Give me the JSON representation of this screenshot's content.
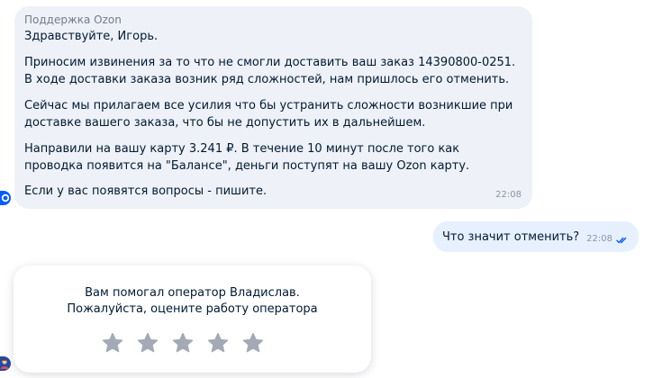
{
  "incoming": {
    "sender": "Поддержка Ozon",
    "greeting": "Здравствуйте, Игорь.",
    "paragraphs": [
      "Приносим извинения за то что не смогли доставить ваш заказ 14390800-0251. В ходе доставки заказа возник ряд сложностей, нам пришлось его отменить.",
      "Сейчас мы прилагаем все усилия что бы устранить сложности возникшие при доставке вашего заказа, что бы не допустить их в дальнейшем.",
      "Направили на вашу карту 3.241 ₽. В течение 10 минут после того как проводка появится на \"Балансе\", деньги поступят на вашу Ozon карту.",
      "Если у вас появятся вопросы - пишите."
    ],
    "time": "22:08"
  },
  "outgoing": {
    "text": "Что значит отменить?",
    "time": "22:08",
    "status_icon": "double-check-icon"
  },
  "rating": {
    "line1": "Вам помогал оператор Владислав.",
    "line2": "Пожалуйста, оцените работу оператора",
    "stars": 5,
    "star_icon": "star-icon"
  },
  "colors": {
    "incoming_bg": "#eef1f7",
    "outgoing_bg": "#e6f0ff",
    "accent": "#005bff",
    "star": "#a3aab5",
    "text": "#001a34",
    "muted": "#707f8d"
  }
}
